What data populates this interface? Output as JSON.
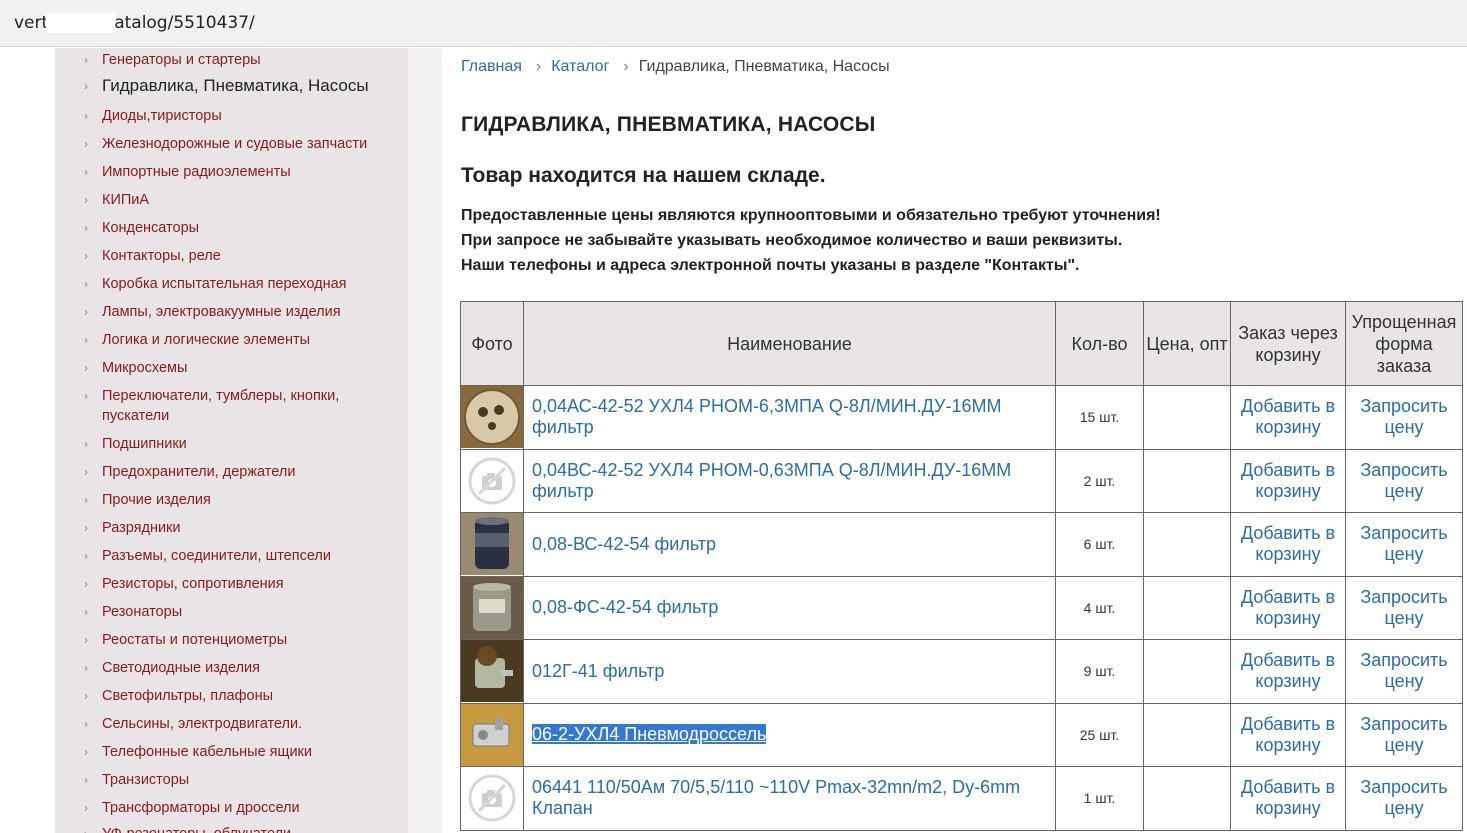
{
  "browser": {
    "url_prefix": "vert",
    "url_suffix": "atalog/5510437/"
  },
  "sidebar": {
    "items": [
      {
        "label": "Генераторы и стартеры",
        "active": false
      },
      {
        "label": "Гидравлика, Пневматика, Насосы",
        "active": true
      },
      {
        "label": "Диоды,тиристоры",
        "active": false
      },
      {
        "label": "Железнодорожные и судовые запчасти",
        "active": false
      },
      {
        "label": "Импортные радиоэлементы",
        "active": false
      },
      {
        "label": "КИПиА",
        "active": false
      },
      {
        "label": "Конденсаторы",
        "active": false
      },
      {
        "label": "Контакторы, реле",
        "active": false
      },
      {
        "label": "Коробка испытательная переходная",
        "active": false
      },
      {
        "label": "Лампы, электровакуумные изделия",
        "active": false
      },
      {
        "label": "Логика и логические элементы",
        "active": false
      },
      {
        "label": "Микросхемы",
        "active": false
      },
      {
        "label": "Переключатели, тумблеры, кнопки, пускатели",
        "active": false
      },
      {
        "label": "Подшипники",
        "active": false
      },
      {
        "label": "Предохранители, держатели",
        "active": false
      },
      {
        "label": "Прочие изделия",
        "active": false
      },
      {
        "label": "Разрядники",
        "active": false
      },
      {
        "label": "Разъемы, соединители, штепсели",
        "active": false
      },
      {
        "label": "Резисторы, сопротивления",
        "active": false
      },
      {
        "label": "Резонаторы",
        "active": false
      },
      {
        "label": "Реостаты и потенциометры",
        "active": false
      },
      {
        "label": "Светодиодные изделия",
        "active": false
      },
      {
        "label": "Светофильтры, плафоны",
        "active": false
      },
      {
        "label": "Сельсины, электродвигатели.",
        "active": false
      },
      {
        "label": "Телефонные кабельные ящики",
        "active": false
      },
      {
        "label": "Транзисторы",
        "active": false
      },
      {
        "label": "Трансформаторы и дроссели",
        "active": false
      },
      {
        "label": "УФ-резонаторы, облучатели",
        "active": false
      }
    ]
  },
  "breadcrumb": {
    "home": "Главная",
    "catalog": "Каталог",
    "current": "Гидравлика, Пневматика, Насосы"
  },
  "page": {
    "title": "ГИДРАВЛИКА, ПНЕВМАТИКА, НАСОСЫ",
    "stock_note": "Товар находится на нашем складе.",
    "notice_lines": [
      "Предоставленные цены являются крупнооптовыми и обязательно требуют уточнения!",
      "При запросе не забывайте указывать необходимое количество и ваши реквизиты.",
      "Наши телефоны и адреса электронной почты указаны в разделе \"Контакты\"."
    ]
  },
  "table": {
    "headers": {
      "photo": "Фото",
      "name": "Наименование",
      "qty": "Кол-во",
      "price": "Цена, опт",
      "cart": "Заказ через корзину",
      "simple": "Упрощенная форма заказа"
    },
    "add_to_cart_label": "Добавить в корзину",
    "request_price_label": "Запросить цену",
    "rows": [
      {
        "name": "0,04АС-42-52 УХЛ4 РНОМ-6,3МПА Q-8Л/МИН.ДУ-16ММ фильтр",
        "qty": "15 шт.",
        "price": "",
        "photo": "beige-disc-photo",
        "selected": false
      },
      {
        "name": "0,04ВС-42-52 УХЛ4 РНОМ-0,63МПА Q-8Л/МИН.ДУ-16ММ фильтр",
        "qty": "2 шт.",
        "price": "",
        "photo": "no-photo-camera-icon",
        "selected": false
      },
      {
        "name": "0,08-ВС-42-54 фильтр",
        "qty": "6 шт.",
        "price": "",
        "photo": "dark-cylinder-photo",
        "selected": false
      },
      {
        "name": "0,08-ФС-42-54 фильтр",
        "qty": "4 шт.",
        "price": "",
        "photo": "grey-cylinder-photo",
        "selected": false
      },
      {
        "name": "012Г-41 фильтр",
        "qty": "9 шт.",
        "price": "",
        "photo": "spool-filter-photo",
        "selected": false
      },
      {
        "name": "06-2-УХЛ4 Пневмодроссель",
        "qty": "25 шт.",
        "price": "",
        "photo": "metal-valve-photo",
        "selected": true
      },
      {
        "name": "06441 110/50Ам 70/5,5/110 ~110V Pmax-32mn/m2, Dy-6mm Клапан",
        "qty": "1 шт.",
        "price": "",
        "photo": "no-photo-camera-icon",
        "selected": false
      }
    ]
  },
  "colors": {
    "link": "#2a6ea6",
    "sidebar_link": "#8b1a1a",
    "sidebar_bg": "#e9e5e6",
    "selection": "#3478d6"
  }
}
